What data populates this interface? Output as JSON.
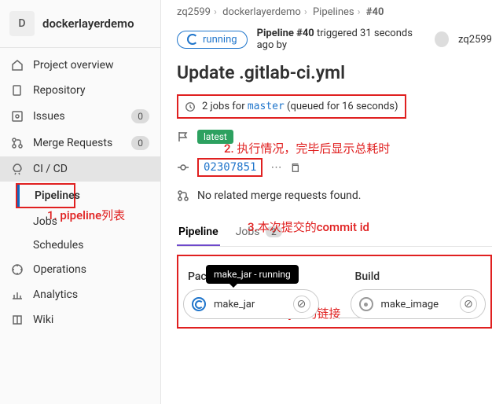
{
  "project": {
    "initial": "D",
    "name": "dockerlayerdemo"
  },
  "sidebar": {
    "items": [
      {
        "label": "Project overview"
      },
      {
        "label": "Repository"
      },
      {
        "label": "Issues",
        "count": "0"
      },
      {
        "label": "Merge Requests",
        "count": "0"
      },
      {
        "label": "CI / CD"
      },
      {
        "label": "Operations"
      },
      {
        "label": "Analytics"
      },
      {
        "label": "Wiki"
      }
    ],
    "sub": {
      "pipelines": "Pipelines",
      "jobs": "Jobs",
      "schedules": "Schedules"
    }
  },
  "breadcrumb": {
    "a": "zq2599",
    "b": "dockerlayerdemo",
    "c": "Pipelines",
    "d": "#40"
  },
  "status": {
    "pill": "running",
    "line_pre": "Pipeline #40",
    "line_mid": " triggered 31 seconds ago by ",
    "user": "zq2599"
  },
  "title": "Update .gitlab-ci.yml",
  "summary": {
    "pre": "2 jobs for ",
    "branch": "master",
    "post": " (queued for 16 seconds)"
  },
  "badges": {
    "latest": "latest"
  },
  "commit": {
    "sha": "02307851",
    "ell": "⋯"
  },
  "mr": {
    "text": "No related merge requests found."
  },
  "tabs": {
    "pipeline": "Pipeline",
    "jobs": "Jobs",
    "jobs_count": "2"
  },
  "stages": [
    {
      "name": "Package",
      "job": "make_jar",
      "tooltip": "make_jar - running",
      "state": "running"
    },
    {
      "name": "Build",
      "job": "make_image",
      "state": "created"
    }
  ],
  "annotations": {
    "a1": "1. pipeline列表",
    "a2": "2. 执行情况，完毕后显示总耗时",
    "a3": "3.本次提交的commit id",
    "a4": "4.job的链接"
  }
}
